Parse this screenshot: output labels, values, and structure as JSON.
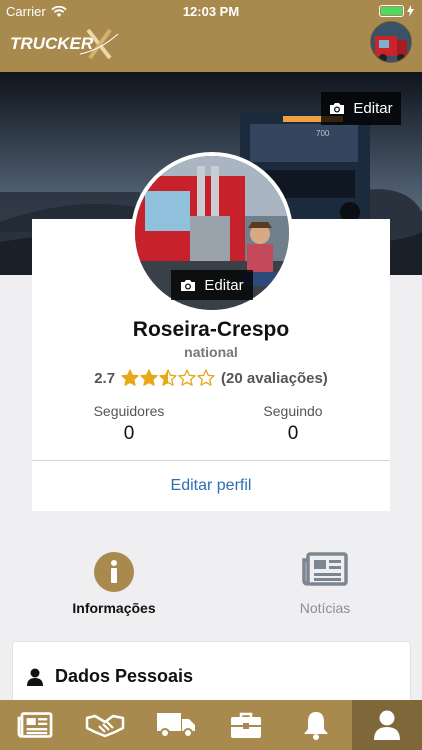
{
  "status_bar": {
    "carrier": "Carrier",
    "time": "12:03 PM"
  },
  "header": {
    "logo_text": "TRUCKERX",
    "logo_icon": "truckerx-logo",
    "avatar_icon": "user-avatar"
  },
  "cover": {
    "edit_label": "Editar",
    "icon": "camera-icon"
  },
  "profile": {
    "avatar_edit_label": "Editar",
    "name": "Roseira-Crespo",
    "subtitle": "national",
    "rating_value": "2.7",
    "rating_score": 2.5,
    "rating_max": 5,
    "reviews": "(20 avaliações)",
    "followers_label": "Seguidores",
    "followers_count": "0",
    "following_label": "Seguindo",
    "following_count": "0",
    "edit_profile_label": "Editar perfil"
  },
  "tabs": [
    {
      "label": "Informações",
      "icon": "info-icon",
      "active": true
    },
    {
      "label": "Notícias",
      "icon": "newspaper-icon",
      "active": false
    }
  ],
  "section": {
    "title": "Dados Pessoais",
    "icon": "person-icon"
  },
  "bottom_nav": [
    {
      "icon": "newspaper-icon",
      "active": false
    },
    {
      "icon": "handshake-icon",
      "active": false
    },
    {
      "icon": "truck-icon",
      "active": false
    },
    {
      "icon": "briefcase-icon",
      "active": false
    },
    {
      "icon": "bell-icon",
      "active": false
    },
    {
      "icon": "user-icon",
      "active": true
    }
  ],
  "colors": {
    "brand": "#a98a4e",
    "brand_dark": "#7e6738",
    "link": "#2e6fb4",
    "star": "#e6a817"
  }
}
